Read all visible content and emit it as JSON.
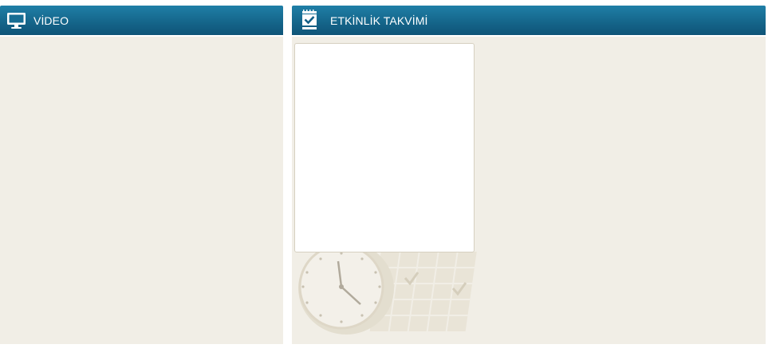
{
  "video_panel": {
    "title": "VİDEO",
    "icon": "monitor-icon"
  },
  "events_panel": {
    "title": "ETKİNLİK TAKVİMİ",
    "icon": "calendar-check-icon",
    "watermark": "clock-calendar-watermark"
  },
  "colors": {
    "header_top": "#1f7fa7",
    "header_bottom": "#0f5478",
    "panel_body": "#f1eee6",
    "page_background": "#ffffff"
  }
}
